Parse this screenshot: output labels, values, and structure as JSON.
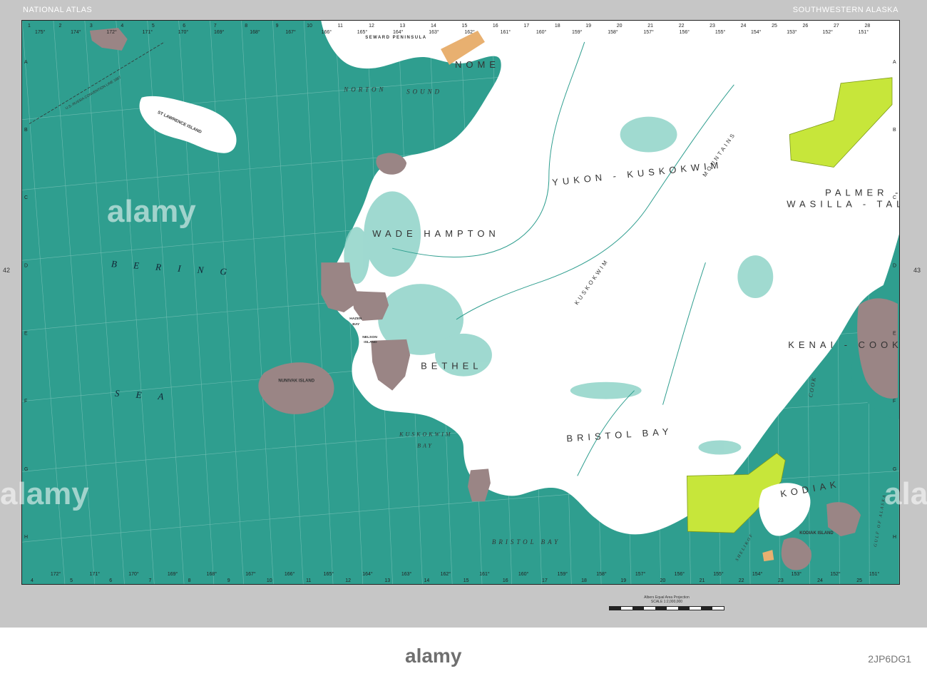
{
  "header": {
    "left": "NATIONAL ATLAS",
    "right": "SOUTHWESTERN ALASKA"
  },
  "page_numbers": {
    "left": "42",
    "right": "43"
  },
  "colors": {
    "ocean": "#2f9e8f",
    "land": "#ffffff",
    "wetland": "#8fd3c8",
    "reservation": "#9a8585",
    "park": "#c7e63a",
    "native_land": "#e8b070",
    "margin": "#c6c6c6"
  },
  "labels": {
    "bering_sea_1": "B E R I N G",
    "bering_sea_2": "S E A",
    "norton_sound_1": "NORTON",
    "norton_sound_2": "SOUND",
    "seward_peninsula": "SEWARD PENINSULA",
    "nome": "NOME",
    "yukon_kuskokwim": "YUKON - KUSKOKWIM",
    "wade_hampton": "WADE HAMPTON",
    "bethel": "BETHEL",
    "bristol_bay_region": "BRISTOL BAY",
    "bristol_bay_water": "BRISTOL   BAY",
    "kuskokwim_bay_1": "KUSKOKWIM",
    "kuskokwim_bay_2": "BAY",
    "kenai_cook_inlet": "KENAI - COOK INLET",
    "palmer_1": "PALMER -",
    "palmer_2": "WASILLA - TALKEETNA",
    "kodiak": "KODIAK",
    "kodiak_island": "KODIAK ISLAND",
    "nunivak_island": "NUNIVAK ISLAND",
    "nelson_island_1": "NELSON",
    "nelson_island_2": "ISLAND",
    "st_lawrence_island": "ST LAWRENCE ISLAND",
    "kuskokwim_mountains": "KUSKOKWIM",
    "mountains": "MOUNTAINS",
    "cook_inlet": "COOK",
    "shelikof": "SHELIKOF",
    "gulf_of_alaska": "GULF OF ALASKA",
    "hazen_bay_1": "HAZEN",
    "hazen_bay_2": "BAY",
    "boundary": "U.S.-RUSSIA CONVENTION LINE 1867"
  },
  "grid": {
    "top_cols": [
      "1",
      "2",
      "3",
      "4",
      "5",
      "6",
      "7",
      "8",
      "9",
      "10",
      "11",
      "12",
      "13",
      "14",
      "15",
      "16",
      "17",
      "18",
      "19",
      "20",
      "21",
      "22",
      "23",
      "24",
      "25",
      "26",
      "27",
      "28"
    ],
    "bottom_cols": [
      "4",
      "5",
      "6",
      "7",
      "8",
      "9",
      "10",
      "11",
      "12",
      "13",
      "14",
      "15",
      "16",
      "17",
      "18",
      "19",
      "20",
      "21",
      "22",
      "23",
      "24",
      "25"
    ],
    "rows": [
      "A",
      "B",
      "C",
      "D",
      "E",
      "F",
      "G",
      "H"
    ],
    "top_degrees": [
      "175°",
      "174°",
      "172°",
      "171°",
      "170°",
      "169°",
      "168°",
      "167°",
      "166°",
      "165°",
      "164°",
      "163°",
      "162°",
      "161°",
      "160°",
      "159°",
      "158°",
      "157°",
      "156°",
      "155°",
      "154°",
      "153°",
      "152°",
      "151°"
    ],
    "bottom_degrees": [
      "172°",
      "171°",
      "170°",
      "169°",
      "168°",
      "167°",
      "166°",
      "165°",
      "164°",
      "163°",
      "162°",
      "161°",
      "160°",
      "159°",
      "158°",
      "157°",
      "156°",
      "155°",
      "154°",
      "153°",
      "152°",
      "151°"
    ]
  },
  "projection": "Albers Equal Area Projection",
  "scale": "SCALE 1:2,000,000",
  "watermark": {
    "logo": "alamy",
    "image_id": "2JP6DG1"
  }
}
